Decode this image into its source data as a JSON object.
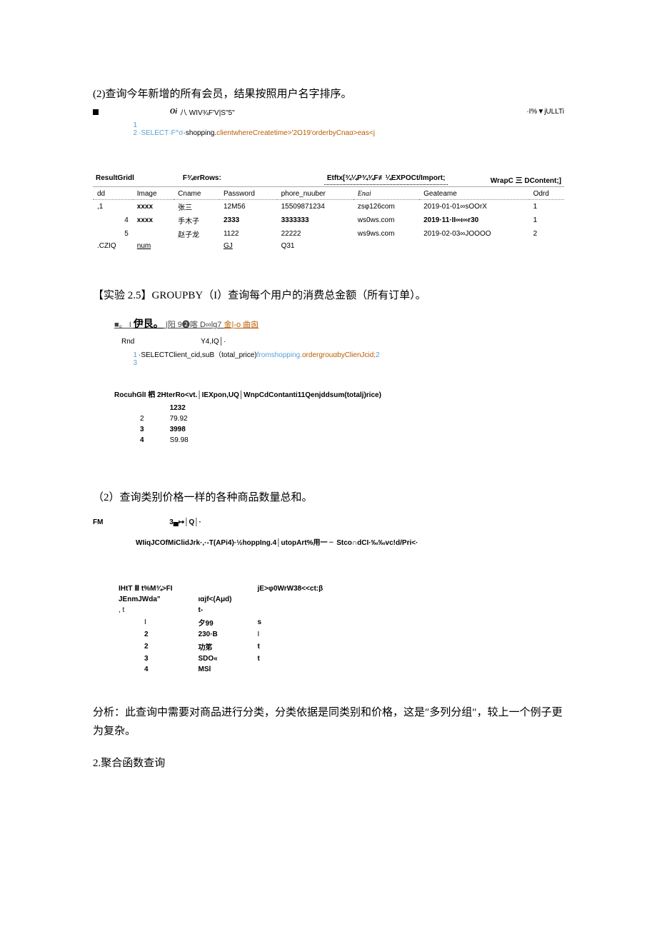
{
  "section_2_2": {
    "prompt": "(2)查询今年新增的所有会员，结果按照用户名字排序。",
    "toolbar": {
      "left_marker": "■",
      "oi": "Oi",
      "garble": "八 WIV¾F'V|S\"5\"",
      "right": "·I%▼jULLTi"
    },
    "sql": {
      "lines": [
        "1",
        "2"
      ],
      "text_prefix": "·SELECT·F^σ",
      "text_mid": "·shopping.",
      "text_mid2": "clientwhereCreatetime>'2O19'orderbyCnaα>eas<j"
    },
    "result_bar": {
      "left": "ResultGridl",
      "filter": "F¾erRows:",
      "mid": "Etftx[¾¼P¾¾F≢¼EXPOCt/Import;",
      "right": "WrapC 三 DContent;]"
    },
    "columns": [
      "dd",
      "Image",
      "Cname",
      "Password",
      "phore_nuuber",
      "Enai",
      "Geateame",
      "Odrd"
    ],
    "rows": [
      {
        "dd": ",1",
        "image": "xxxx",
        "cname": "张三",
        "password": "12M56",
        "phone": "15509871234",
        "enai": "zsφ126com",
        "geat": "2019-01-01∞sOOrX",
        "odrd": "1"
      },
      {
        "dd": "4",
        "image": "xxxx",
        "cname": "手木子",
        "password": "2333",
        "phone": "3333333",
        "enai": "ws0ws.com",
        "geat": "2019·11·II∞ι∞r30",
        "odrd": "1"
      },
      {
        "dd": "5",
        "image": "",
        "cname": "赵子龙",
        "password": "1122",
        "phone": "22222",
        "enai": "ws9ws.com",
        "geat": "2019-02-03∞JOOOO",
        "odrd": "2"
      }
    ],
    "footer_row": {
      "c0": ".CZIQ",
      "c1": "num",
      "c2": "",
      "c3": "GJ",
      "c4": "Q31",
      "c5": "",
      "c6": "",
      "c7": ""
    }
  },
  "section_2_5": {
    "title": "【实验 2.5】GROUPBY（I）查询每个用户的消费总金额（所有订单）。",
    "garble": "■。 I 伊艮。 |阳 9❷喀 D∞lg7 金|-ο 曲囪",
    "rnd_line": {
      "label": "Rnd",
      "value": "Y4,IQ│·"
    },
    "sql": {
      "lines": [
        "1",
        "2",
        "3"
      ],
      "text1": "·SELECTClient_cid,suB（total_price)",
      "text2": "fromshopping.",
      "text3": "ordergrouαbyClienJcid;"
    },
    "result_bar2": "RocuhGlI 柶 2HterRo<vt.│IEXpon,UQ│WnpCdContanti11Qenjddsum(totalj)rice)",
    "rows2": [
      {
        "id": "",
        "val": "1232"
      },
      {
        "id": "2",
        "val": "79.92"
      },
      {
        "id": "3",
        "val": "3998"
      },
      {
        "id": "4",
        "val": "S9.98"
      }
    ]
  },
  "section_2_5b": {
    "prompt": "（2）查询类别价格一样的各种商品数量总和。",
    "fm_line": {
      "label": "FM",
      "value": "3▄↦│Q│·"
    },
    "sql_garble": "WIiqJCOfMiClidJrk·,·-T(APi4)·½hoppIng.4│utopArt%用一 ╴Stco∩dCI·‰‰vc!d/Pri<·",
    "tbl_header": {
      "left": "IHtT Ⅲ t%M¾>FI",
      "right": "jE>φ0WrW38<<ct:β"
    },
    "tbl_sub": {
      "left": "JEnmJWda\"",
      "mid": "ιαjf<(Aμd)"
    },
    "tbl_sub2": {
      "left": ", t",
      "mid": "t-"
    },
    "rows3": [
      {
        "a": "I",
        "b": "夕99",
        "c": "s"
      },
      {
        "a": "2",
        "b": "230·B",
        "c": "I"
      },
      {
        "a": "2",
        "b": "功笫",
        "c": "t"
      },
      {
        "a": "3",
        "b": "SDO«",
        "c": "t"
      },
      {
        "a": "4",
        "b": "MSl",
        "c": ""
      }
    ],
    "analysis": "分析：此查询中需要对商品进行分类，分类依据是同类别和价格，这是″多列分组″，较上一个例子更为复杂。",
    "sub": "2.聚合函数查询"
  }
}
